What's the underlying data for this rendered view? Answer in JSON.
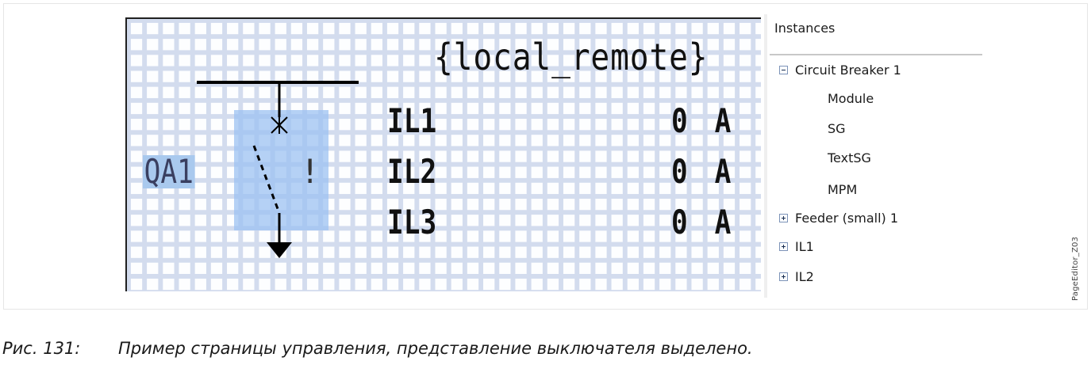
{
  "lcd": {
    "local_remote": "{local_remote}",
    "rows": [
      {
        "label": "IL1",
        "value": "0 A"
      },
      {
        "label": "IL2",
        "value": "0 A"
      },
      {
        "label": "IL3",
        "value": "0 A"
      }
    ],
    "breaker_label": "QA1",
    "breaker_status": "!"
  },
  "tree": {
    "title": "Instances",
    "items": [
      {
        "label": "Circuit Breaker 1",
        "expander": "minus"
      },
      {
        "label": "Module"
      },
      {
        "label": "SG"
      },
      {
        "label": "TextSG"
      },
      {
        "label": "MPM"
      },
      {
        "label": "Feeder (small) 1",
        "expander": "plus"
      },
      {
        "label": "IL1",
        "expander": "plus"
      },
      {
        "label": "IL2",
        "expander": "plus"
      }
    ]
  },
  "side_label": "PageEditor_Z03",
  "caption": {
    "number": "Рис. 131:",
    "text": "Пример страницы управления, представление выключателя выделено."
  },
  "colors": {
    "grid": "#d3dcee",
    "selection": "#9cc2f2",
    "label_highlight": "#a9c9ee"
  }
}
